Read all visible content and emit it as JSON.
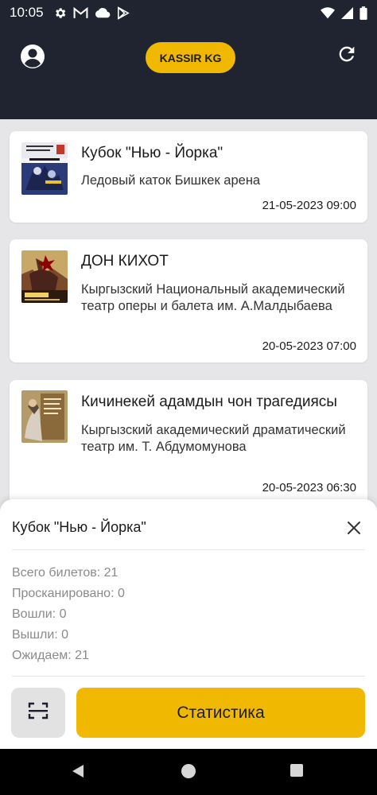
{
  "status_bar": {
    "time": "10:05",
    "left_icons": [
      "gear-icon",
      "gmail-icon",
      "cloud-icon",
      "play-store-icon"
    ],
    "right_icons": [
      "wifi-icon",
      "signal-icon",
      "battery-icon"
    ]
  },
  "header": {
    "brand": "KASSIR KG",
    "brand_color": "#f0b800",
    "profile_icon": "account-circle-icon",
    "refresh_icon": "refresh-icon"
  },
  "events": [
    {
      "title": "Кубок \"Нью - Йорка\"",
      "venue": "Ледовый каток Бишкек арена",
      "date": "21-05-2023 09:00"
    },
    {
      "title": "ДОН КИХОТ",
      "venue": "Кыргызский Национальный академический театр оперы и балета им. А.Малдыбаева",
      "date": "20-05-2023 07:00"
    },
    {
      "title": "Кичинекей адамдын чон трагедиясы",
      "venue": "Кыргызский академический драматический театр им. Т. Абдумомунова",
      "date": "20-05-2023 06:30"
    }
  ],
  "sheet": {
    "title": "Кубок \"Нью - Йорка\"",
    "stats": [
      "Всего билетов: 21",
      "Просканировано: 0",
      "Вошли: 0",
      "Вышли: 0",
      "Ожидаем: 21"
    ],
    "scan_icon": "qr-scan-icon",
    "stats_button": "Статистика"
  },
  "nav": [
    "back-icon",
    "home-icon",
    "recents-icon"
  ]
}
